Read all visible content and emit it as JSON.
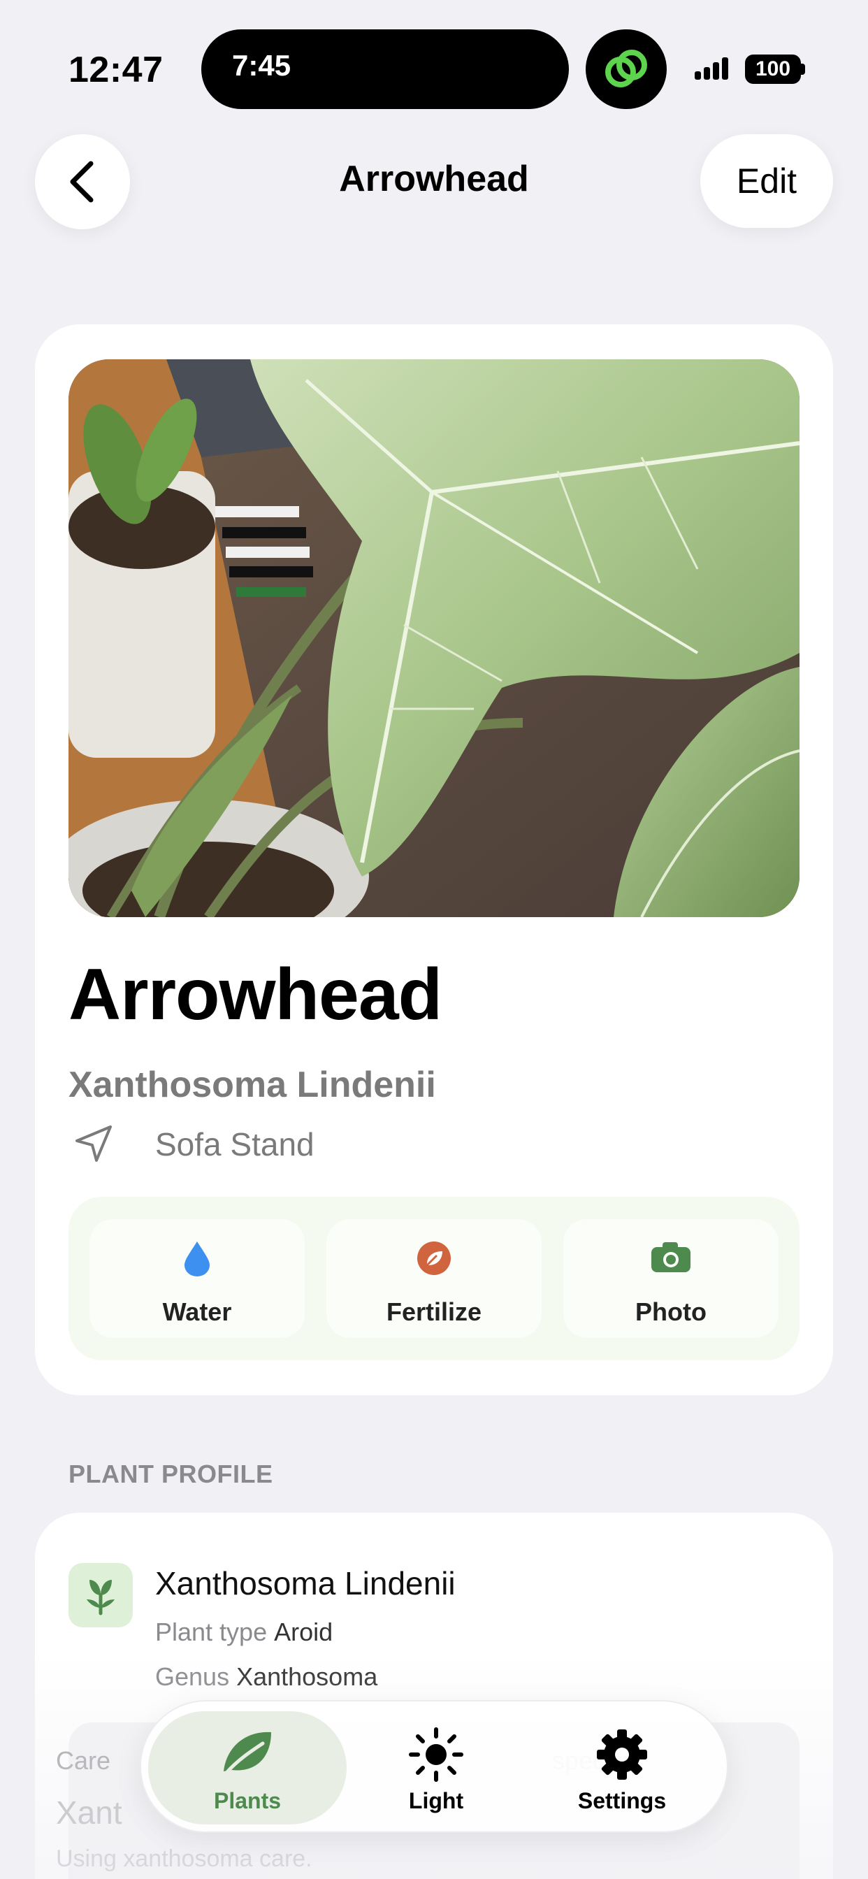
{
  "status": {
    "time": "12:47",
    "activity_time": "7:45",
    "battery": "100"
  },
  "nav": {
    "title": "Arrowhead",
    "edit_label": "Edit"
  },
  "plant": {
    "name": "Arrowhead",
    "species": "Xanthosoma Lindenii",
    "location": "Sofa Stand"
  },
  "actions": [
    {
      "label": "Water",
      "icon": "water-drop-icon",
      "color": "#3d8ff0"
    },
    {
      "label": "Fertilize",
      "icon": "leaf-badge-icon",
      "color": "#d0643e"
    },
    {
      "label": "Photo",
      "icon": "camera-icon",
      "color": "#4e8a4e"
    }
  ],
  "profile": {
    "section_title": "PLANT PROFILE",
    "title": "Xanthosoma Lindenii",
    "plant_type_label": "Plant type",
    "plant_type_value": "Aroid",
    "genus_label": "Genus",
    "genus_value": "Xanthosoma",
    "care_label": "Care",
    "care_right": "species",
    "care_name": "Xant",
    "care_sub": "Using xanthosoma care."
  },
  "tabs": [
    {
      "label": "Plants",
      "icon": "leaf-icon",
      "active": true
    },
    {
      "label": "Light",
      "icon": "sun-icon",
      "active": false
    },
    {
      "label": "Settings",
      "icon": "gear-icon",
      "active": false
    }
  ],
  "colors": {
    "accent": "#4e8a4e",
    "background": "#f1f0f5"
  }
}
